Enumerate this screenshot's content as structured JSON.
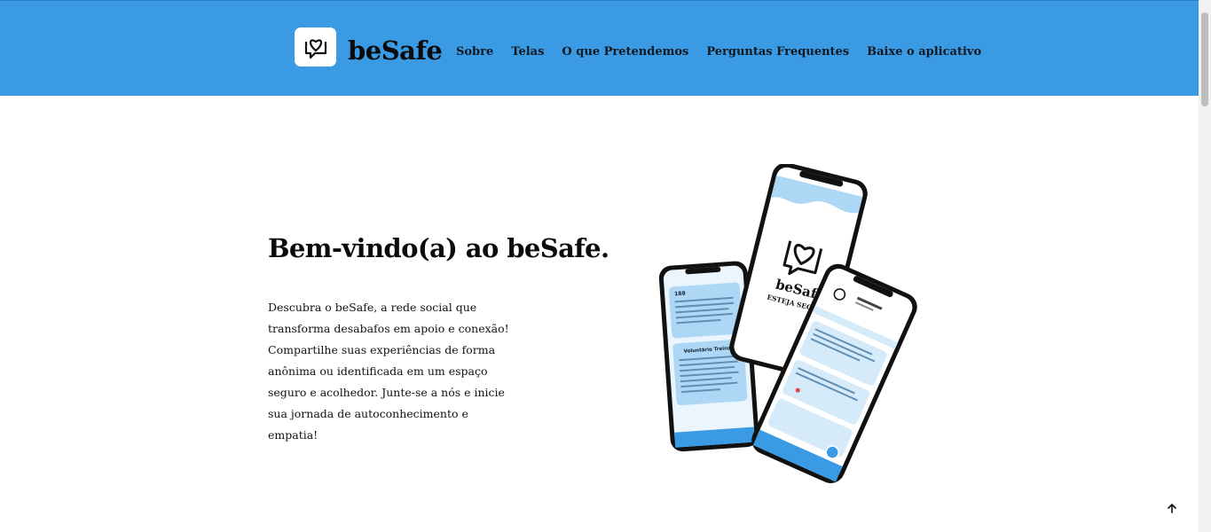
{
  "header": {
    "brand": "beSafe",
    "nav": [
      "Sobre",
      "Telas",
      "O que Pretendemos",
      "Perguntas Frequentes",
      "Baixe o aplicativo"
    ],
    "color": "#3a9be4"
  },
  "hero": {
    "title": "Bem-vindo(a) ao beSafe.",
    "description": "Descubra o beSafe, a rede social que transforma desabafos em apoio e conexão! Compartilhe suas experiências de forma anônima ou identificada em um espaço seguro e acolhedor. Junte-se a nós e inicie sua jornada de autoconhecimento e empatia!"
  },
  "mockup": {
    "splash_brand": "beSafe",
    "splash_tagline": "ESTEJA SEGURO",
    "card_1_title": "188",
    "card_2_title": "Voluntário Treinado"
  },
  "back_to_top_icon": "arrow-up-icon"
}
